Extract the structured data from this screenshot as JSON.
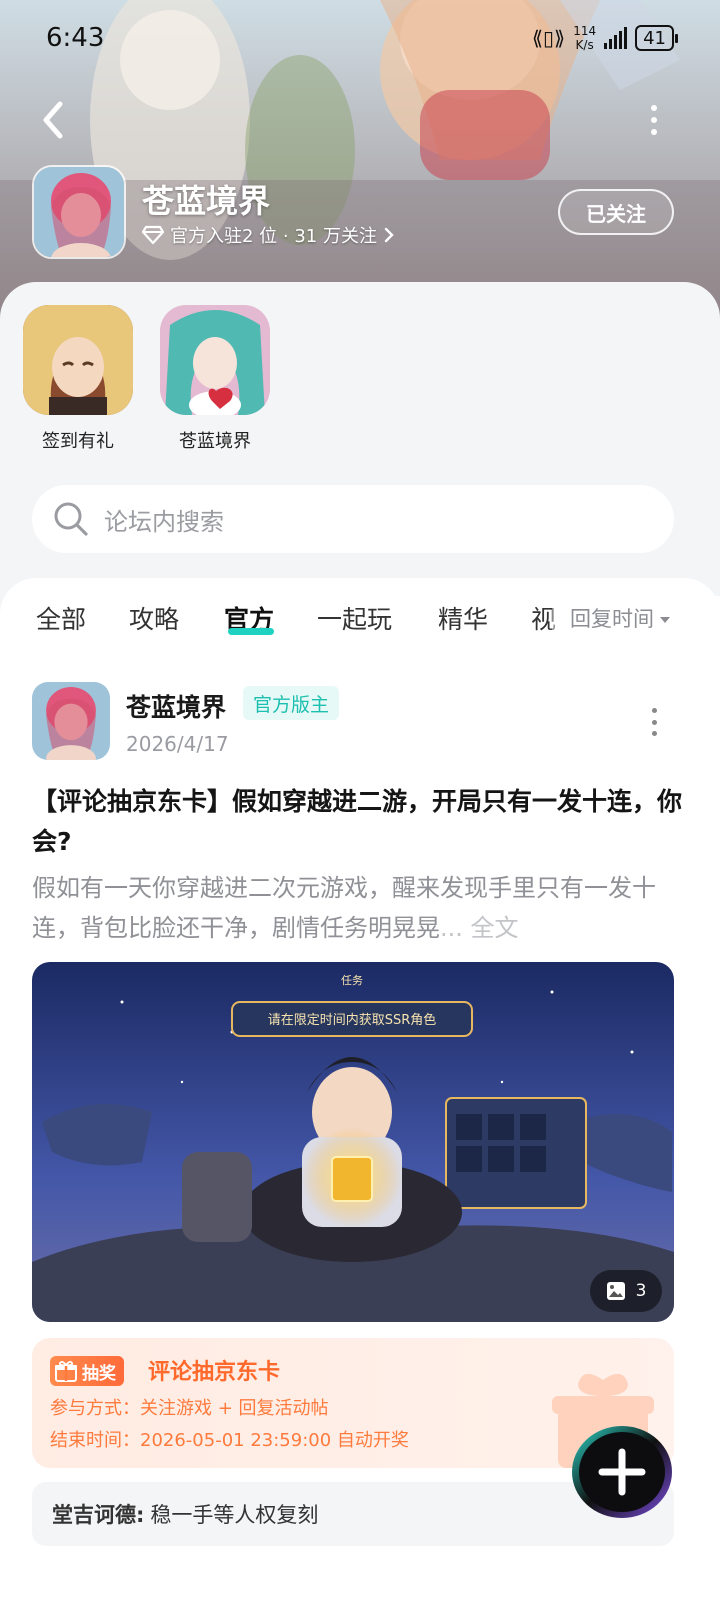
{
  "status_bar": {
    "time": "6:43",
    "speed_value": "114",
    "speed_unit": "K/s",
    "battery": "41"
  },
  "header": {
    "game_name": "苍蓝境界",
    "meta_text": "官方入驻2 位 · 31 万关注",
    "follow_label": "已关注"
  },
  "shortcuts": [
    {
      "label": "签到有礼"
    },
    {
      "label": "苍蓝境界"
    }
  ],
  "search": {
    "placeholder": "论坛内搜索"
  },
  "tabs": [
    {
      "label": "全部"
    },
    {
      "label": "攻略"
    },
    {
      "label": "官方"
    },
    {
      "label": "一起玩"
    },
    {
      "label": "精华"
    },
    {
      "label": "视"
    }
  ],
  "active_tab": "官方",
  "sort": {
    "label": "回复时间"
  },
  "post": {
    "author": "苍蓝境界",
    "badge": "官方版主",
    "date": "2026/4/17",
    "title": "【评论抽京东卡】假如穿越进二游，开局只有一发十连，你会?",
    "excerpt": "假如有一天你穿越进二次元游戏，醒来发现手里只有一发十连，背包比脸还干净，剧情任务明晃晃",
    "excerpt_more": "... 全文",
    "image_count": "3",
    "image_caption": "请在限定时间内获取SSR角色",
    "image_header": "任务"
  },
  "lottery": {
    "tag": "抽奖",
    "title": "评论抽京东卡",
    "method": "参与方式：关注游戏 + 回复活动帖",
    "end_time": "结束时间：2026-05-01 23:59:00 自动开奖"
  },
  "comment": {
    "name": "堂吉诃德:",
    "text": "稳一手等人权复刻"
  },
  "colors": {
    "accent": "#1fd1c1",
    "lottery_orange": "#ff6a2c"
  }
}
